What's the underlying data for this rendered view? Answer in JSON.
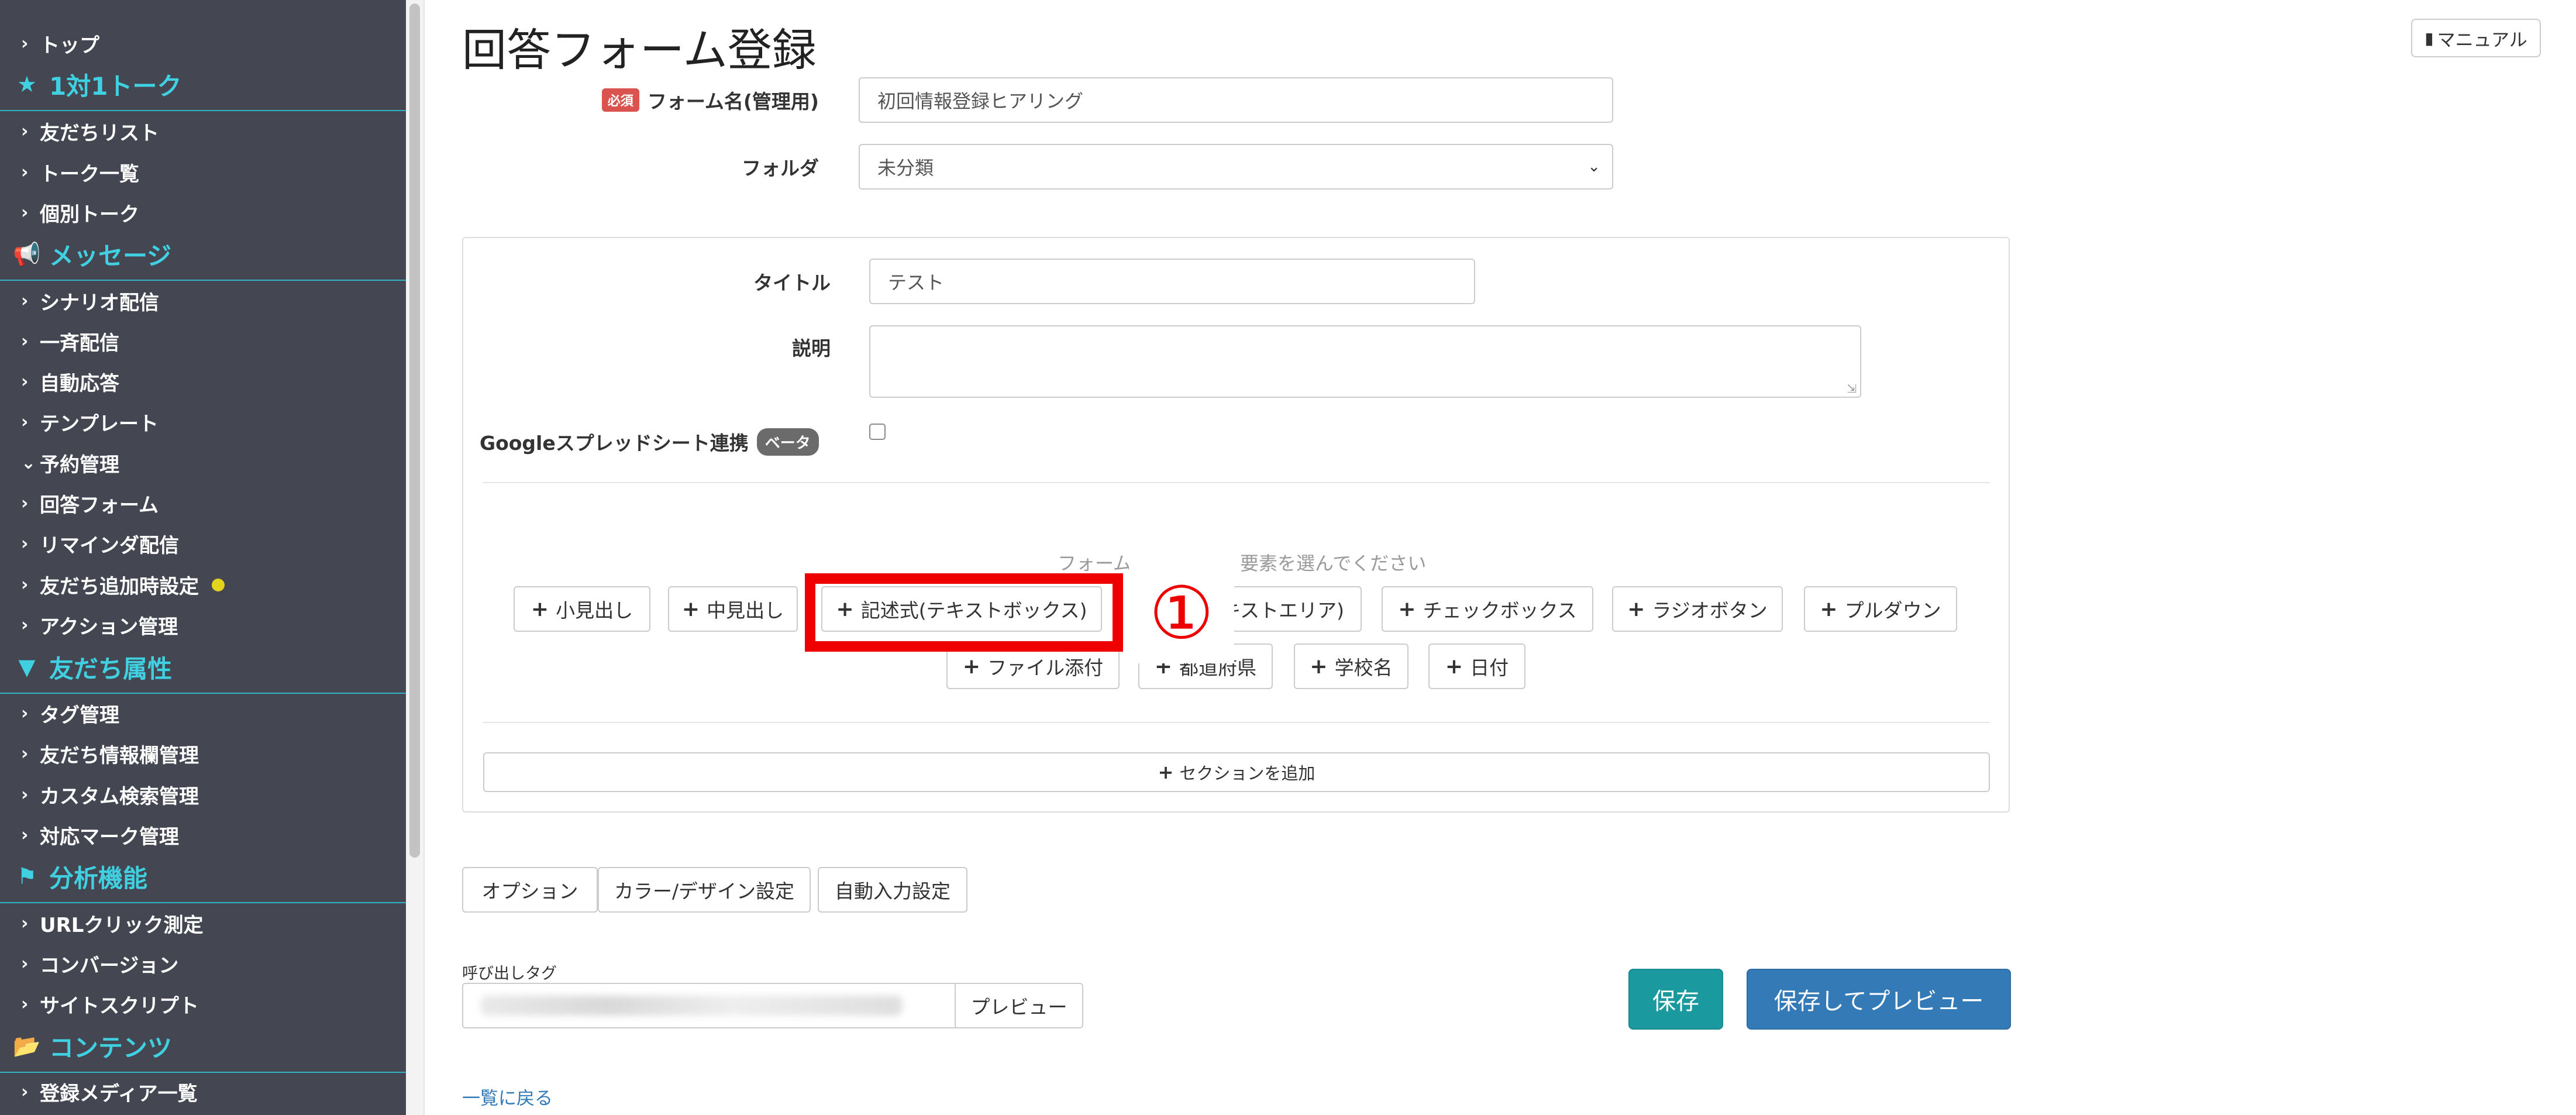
{
  "sidebar": {
    "items": [
      {
        "type": "item",
        "label": "トップ"
      },
      {
        "type": "head",
        "icon": "star-icon",
        "glyph": "★",
        "label": "1対1トーク"
      },
      {
        "type": "item",
        "label": "友だちリスト"
      },
      {
        "type": "item",
        "label": "トーク一覧"
      },
      {
        "type": "item",
        "label": "個別トーク"
      },
      {
        "type": "head",
        "icon": "megaphone-icon",
        "glyph": "📢",
        "label": "メッセージ"
      },
      {
        "type": "item",
        "label": "シナリオ配信"
      },
      {
        "type": "item",
        "label": "一斉配信"
      },
      {
        "type": "item",
        "label": "自動応答"
      },
      {
        "type": "item",
        "label": "テンプレート"
      },
      {
        "type": "item",
        "label": "予約管理",
        "expanded": true
      },
      {
        "type": "item",
        "label": "回答フォーム"
      },
      {
        "type": "item",
        "label": "リマインダ配信"
      },
      {
        "type": "item",
        "label": "友だち追加時設定",
        "dot": true
      },
      {
        "type": "item",
        "label": "アクション管理"
      },
      {
        "type": "head",
        "icon": "filter-icon",
        "glyph": "▼",
        "label": "友だち属性"
      },
      {
        "type": "item",
        "label": "タグ管理"
      },
      {
        "type": "item",
        "label": "友だち情報欄管理"
      },
      {
        "type": "item",
        "label": "カスタム検索管理"
      },
      {
        "type": "item",
        "label": "対応マーク管理"
      },
      {
        "type": "head",
        "icon": "flag-icon",
        "glyph": "⚑",
        "label": "分析機能"
      },
      {
        "type": "item",
        "label": "URLクリック測定"
      },
      {
        "type": "item",
        "label": "コンバージョン"
      },
      {
        "type": "item",
        "label": "サイトスクリプト"
      },
      {
        "type": "head",
        "icon": "folder-open-icon",
        "glyph": "📂",
        "label": "コンテンツ"
      },
      {
        "type": "item",
        "label": "登録メディア一覧"
      }
    ]
  },
  "header": {
    "title": "回答フォーム登録",
    "manual_label": "マニュアル",
    "manual_icon": "book-icon"
  },
  "form": {
    "required_badge": "必須",
    "name_label": "フォーム名(管理用)",
    "name_value": "初回情報登録ヒアリング",
    "folder_label": "フォルダ",
    "folder_value": "未分類"
  },
  "panel": {
    "title_label": "タイトル",
    "title_value": "テスト",
    "desc_label": "説明",
    "desc_value": "",
    "gsheet_label": "Googleスプレッドシート連携",
    "beta_badge": "ベータ",
    "gsheet_checked": false,
    "hint_left": "フォーム",
    "hint_right": "要素を選んでください",
    "element_buttons_row1": [
      "小見出し",
      "中見出し",
      "記述式(テキストボックス)",
      "テキストエリア)",
      "チェックボックス",
      "ラジオボタン",
      "プルダウン"
    ],
    "element_buttons_row2": [
      "ファイル添付",
      "都道府県",
      "学校名",
      "日付"
    ],
    "annotation_number": "①",
    "add_section_label": "セクションを追加"
  },
  "settings_buttons": [
    "オプション",
    "カラー/デザイン設定",
    "自動入力設定"
  ],
  "call_tag": {
    "label": "呼び出しタグ",
    "preview_label": "プレビュー"
  },
  "actions": {
    "save_label": "保存",
    "save_preview_label": "保存してプレビュー"
  },
  "back_link": "一覧に戻る",
  "colors": {
    "sidebar_bg": "#444751",
    "sidebar_heading": "#3fd0e2",
    "save_button": "#1a9a9e",
    "save_preview_button": "#337ab7",
    "annotation_red": "#ee0000",
    "required_badge": "#d9534f"
  }
}
